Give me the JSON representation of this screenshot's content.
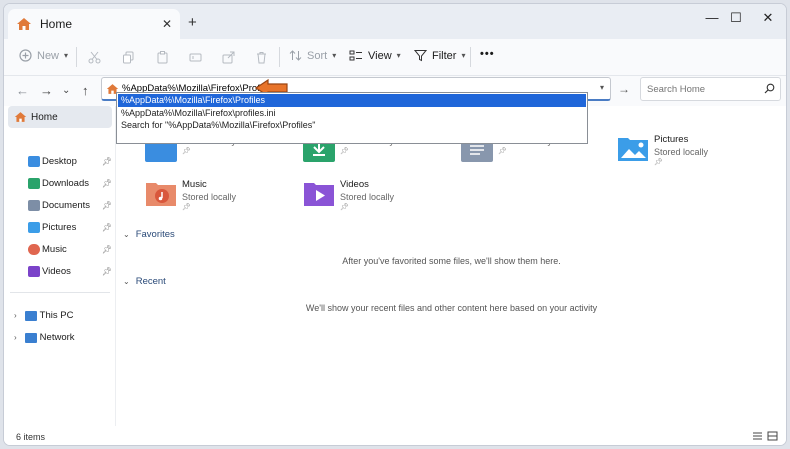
{
  "window": {
    "tab_title": "Home",
    "new_tab": "+",
    "close_tab": "✕",
    "minimize": "—",
    "maximize": "☐",
    "close": "✕"
  },
  "toolbar": {
    "new_label": "New",
    "sort_label": "Sort",
    "view_label": "View",
    "filter_label": "Filter",
    "more_label": "•••"
  },
  "address": {
    "value": "%AppData%\\Mozilla\\Firefox\\Profiles",
    "search_placeholder": "Search Home",
    "suggestions": [
      "%AppData%\\Mozilla\\Firefox\\Profiles",
      "%AppData%\\Mozilla\\Firefox\\profiles.ini",
      "Search for \"%AppData%\\Mozilla\\Firefox\\Profiles\""
    ]
  },
  "sidebar": {
    "home": "Home",
    "items": [
      {
        "label": "Desktop",
        "icon": "desktop-icon"
      },
      {
        "label": "Downloads",
        "icon": "downloads-icon"
      },
      {
        "label": "Documents",
        "icon": "documents-icon"
      },
      {
        "label": "Pictures",
        "icon": "pictures-icon"
      },
      {
        "label": "Music",
        "icon": "music-icon"
      },
      {
        "label": "Videos",
        "icon": "videos-icon"
      }
    ],
    "tree": [
      {
        "label": "This PC",
        "icon": "this-pc-icon"
      },
      {
        "label": "Network",
        "icon": "network-icon"
      }
    ]
  },
  "quick_access": [
    {
      "name": "",
      "sub": "Stored locally"
    },
    {
      "name": "",
      "sub": "Stored locally"
    },
    {
      "name": "",
      "sub": "Stored locally"
    },
    {
      "name": "Pictures",
      "sub": "Stored locally"
    },
    {
      "name": "Music",
      "sub": "Stored locally"
    },
    {
      "name": "Videos",
      "sub": "Stored locally"
    }
  ],
  "sections": {
    "favorites": "Favorites",
    "favorites_empty": "After you've favorited some files, we'll show them here.",
    "recent": "Recent",
    "recent_empty": "We'll show your recent files and other content here based on your activity"
  },
  "status": {
    "count": "6 items"
  },
  "colors": {
    "accent": "#1f66d9",
    "arrow": "#e8742a"
  }
}
